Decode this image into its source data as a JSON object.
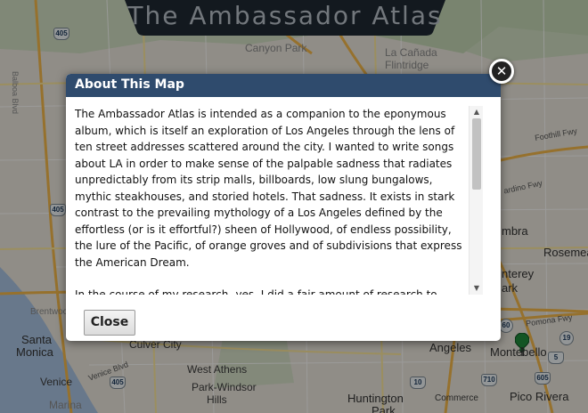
{
  "app": {
    "title": "The Ambassador Atlas"
  },
  "map": {
    "labels": {
      "canyon_park": "Canyon Park",
      "la_canada": "La Cañada",
      "flintridge": "Flintridge",
      "santa_monica": "Santa",
      "santa_monica_2": "Monica",
      "culver_city": "Culver City",
      "venice": "Venice",
      "park_windsor": "Park-Windsor",
      "hills": "Hills",
      "west_athens": "West Athens",
      "huntington_park": "Huntington",
      "huntington_park_2": "Park",
      "angeles": "Angeles",
      "montebello": "Montebello",
      "pico_rivera": "Pico Rivera",
      "rosemead": "Rosemead",
      "monterey_park": "nterey",
      "monterey_park_2": "ark",
      "alhambra": "mbra",
      "brentwood": "Brentwood",
      "commerce": "Commerce",
      "marina": "Marina",
      "foothill_fwy": "Foothill Fwy",
      "pomona_fwy": "Pomona Fwy",
      "san_bernardino_fwy": "ardino Fwy",
      "venice_blvd": "Venice Blvd",
      "balboa_blvd": "Balboa Blvd"
    },
    "shields": {
      "i405_north": "405",
      "i405_mid": "405",
      "i405_south": "405",
      "i10": "10",
      "i5": "5",
      "sr19": "19",
      "i710": "710",
      "i605": "605",
      "sr60": "60"
    }
  },
  "modal": {
    "title": "About This Map",
    "paragraphs": [
      "The Ambassador Atlas is intended as a companion to the eponymous album, which is itself an exploration of Los Angeles through the lens of ten street addresses scattered around the city. I wanted to write songs about LA in order to make sense of the palpable sadness that radiates unpredictably from its strip malls, billboards, low slung bungalows, mythic steakhouses, and storied hotels. That sadness. It exists in stark contrast to the prevailing mythology of a Los Angeles defined by the effortless (or is it effortful?) sheen of Hollywood, of endless possibility, the lure of the Pacific, of orange groves and of subdivisions that express the American Dream.",
      "In the course of my research- yes, I did a fair amount of research to write"
    ],
    "close_label": "Close",
    "close_x": "✕",
    "scroll_up": "▲",
    "scroll_down": "▼"
  },
  "colors": {
    "modal_header": "#2f4b6d",
    "marker": "#1f8a3a"
  }
}
